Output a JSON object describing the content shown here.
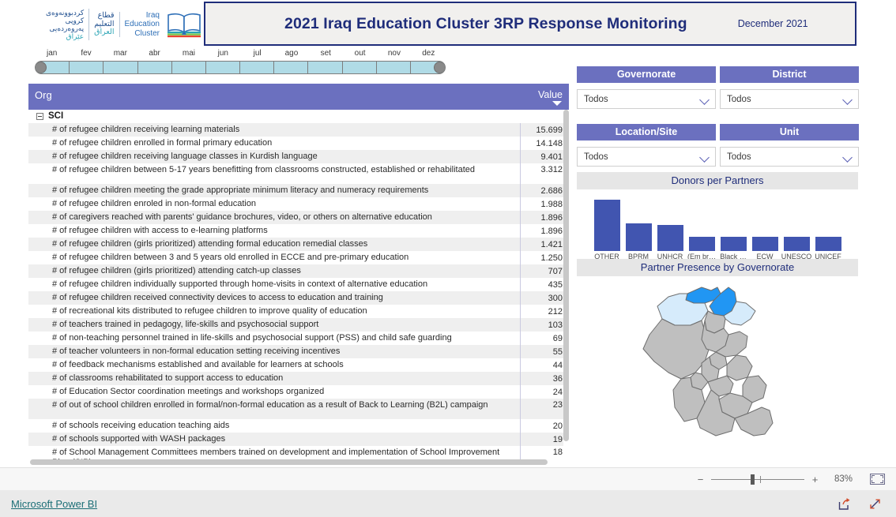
{
  "header": {
    "logo": {
      "kurdish_line1": "كردبوونەوەی",
      "kurdish_line2": "كروپی پەروەردەیی",
      "kurdish_line3": "عێراق",
      "arabic_line1": "قطاع",
      "arabic_line2": "التعليم",
      "arabic_line3": "العراق",
      "english_line1": "Iraq",
      "english_line2": "Education",
      "english_line3": "Cluster",
      "icon": "open-book-icon"
    },
    "title": "2021 Iraq Education Cluster 3RP Response Monitoring",
    "date": "December 2021"
  },
  "month_slider": {
    "months": [
      "jan",
      "fev",
      "mar",
      "abr",
      "mai",
      "jun",
      "jul",
      "ago",
      "set",
      "out",
      "nov",
      "dez"
    ],
    "track_color": "#b0dbe6"
  },
  "table": {
    "columns": [
      "Org",
      "Value"
    ],
    "sort_column": "Value",
    "sort_direction": "descending",
    "header_color": "#6b70bf",
    "group": "SCI",
    "rows": [
      {
        "label": "# of refugee children receiving learning materials",
        "value": "15.699"
      },
      {
        "label": "# of refugee children enrolled in formal primary education",
        "value": "14.148"
      },
      {
        "label": "# of refugee children receiving language classes in Kurdish language",
        "value": "9.401"
      },
      {
        "label": "# of refugee children between 5-17 years benefitting from classrooms constructed, established or rehabilitated",
        "value": "3.312"
      },
      {
        "label": "# of refugee children meeting the grade appropriate minimum literacy and numeracy requirements",
        "value": "2.686"
      },
      {
        "label": "# of refugee children enroled in non-formal education",
        "value": "1.988"
      },
      {
        "label": "# of caregivers reached with parents' guidance brochures, video, or others on alternative education",
        "value": "1.896"
      },
      {
        "label": "# of refugee children with access to e-learning platforms",
        "value": "1.896"
      },
      {
        "label": "# of refugee children (girls prioritized) attending formal education remedial classes",
        "value": "1.421"
      },
      {
        "label": "# of refugee children between 3 and 5 years old enrolled in ECCE and pre-primary education",
        "value": "1.250"
      },
      {
        "label": "# of refugee children (girls prioritized) attending catch-up classes",
        "value": "707"
      },
      {
        "label": "# of refugee children individually supported through home-visits in context of alternative education",
        "value": "435"
      },
      {
        "label": "# of refugee children received connectivity devices to access to education and training",
        "value": "300"
      },
      {
        "label": "# of recreational kits distributed to refugee children to improve quality of education",
        "value": "212"
      },
      {
        "label": "# of teachers trained in pedagogy, life-skills and psychosocial support",
        "value": "103"
      },
      {
        "label": "# of non-teaching personnel trained in life-skills and psychosocial support (PSS) and child safe guarding",
        "value": "69"
      },
      {
        "label": "# of teacher volunteers in non-formal education setting receiving incentives",
        "value": "55"
      },
      {
        "label": "# of feedback mechanisms established and available for learners at schools",
        "value": "44"
      },
      {
        "label": "# of classrooms rehabilitated to support access to education",
        "value": "36"
      },
      {
        "label": "# of Education Sector coordination meetings and workshops organized",
        "value": "24"
      },
      {
        "label": "# of out of school children enrolled in formal/non-formal education as a result of Back to Learning (B2L) campaign",
        "value": "23"
      },
      {
        "label": "# of schools receiving education teaching aids",
        "value": "20"
      },
      {
        "label": "# of schools supported with WASH packages",
        "value": "19"
      },
      {
        "label": "# of School Management Committees members trained on development and implementation of School Improvement Plan (SIP)",
        "value": "18"
      }
    ]
  },
  "filters": [
    {
      "title": "Governorate",
      "value": "Todos"
    },
    {
      "title": "District",
      "value": "Todos"
    },
    {
      "title": "Location/Site",
      "value": "Todos"
    },
    {
      "title": "Unit",
      "value": "Todos"
    }
  ],
  "chart_data": {
    "type": "bar",
    "title": "Donors per Partners",
    "categories": [
      "OTHER",
      "BPRM",
      "UNHCR",
      "(Em br…",
      "Black …",
      "ECW",
      "UNESCO",
      "UNICEF"
    ],
    "values": [
      62,
      33,
      32,
      17,
      17,
      17,
      17,
      17
    ],
    "xlabel": "",
    "ylabel": "",
    "ylim": [
      0,
      65
    ],
    "grid": false,
    "legend": "none",
    "bar_color": "#4155b0"
  },
  "map": {
    "title": "Partner Presence by Governorate",
    "colors": {
      "high": "#2196f3",
      "low": "#d6ebfb",
      "none": "#bfbfbf",
      "border": "#6e6e6e"
    }
  },
  "bottom_bar": {
    "zoom_out_label": "−",
    "zoom_in_label": "+",
    "zoom_level": "83%",
    "fit_icon": "fit-to-page-icon"
  },
  "footer": {
    "link_label": "Microsoft Power BI",
    "share_icon": "share-icon",
    "fullscreen_icon": "fullscreen-icon"
  }
}
